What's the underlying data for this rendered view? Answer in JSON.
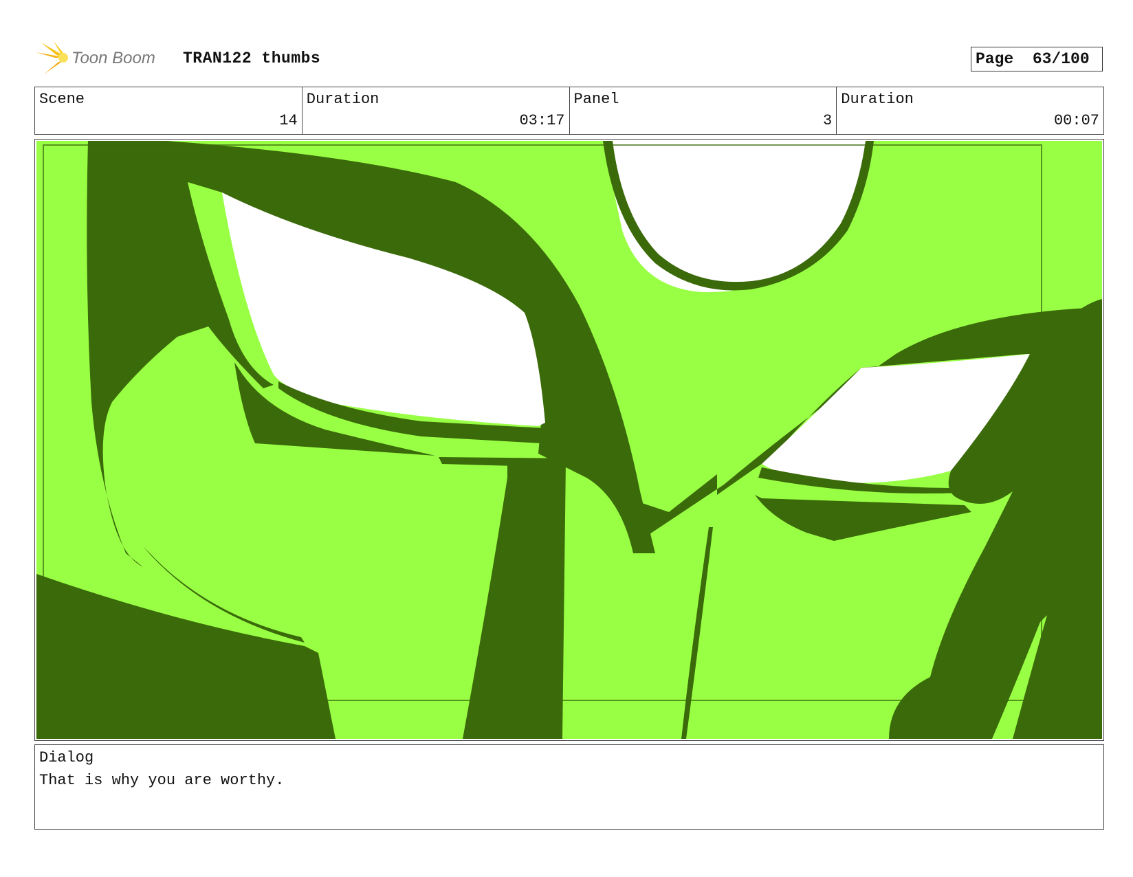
{
  "header": {
    "logo_text": "Toon Boom",
    "title": "TRAN122 thumbs",
    "page_label": "Page",
    "page_number": "63/100"
  },
  "info": {
    "scene_label": "Scene",
    "scene_value": "14",
    "scene_duration_label": "Duration",
    "scene_duration_value": "03:17",
    "panel_label": "Panel",
    "panel_value": "3",
    "panel_duration_label": "Duration",
    "panel_duration_value": "00:07"
  },
  "dialog": {
    "label": "Dialog",
    "text": "That is why you are worthy."
  },
  "colors": {
    "panel_light_green": "#99ff44",
    "panel_dark_green": "#3a6a0a",
    "logo_yellow": "#f7c21a",
    "logo_gray": "#777777"
  }
}
